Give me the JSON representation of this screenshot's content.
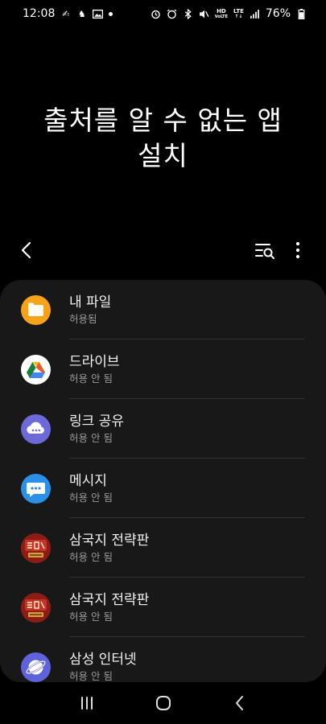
{
  "status_bar": {
    "time": "12:08",
    "network_top": "HD",
    "network_bottom": "VoLTE",
    "lte_top": "LTE",
    "battery": "76%"
  },
  "title": "출처를 알 수 없는 앱\n설치",
  "apps": [
    {
      "name": "내 파일",
      "status": "허용됨",
      "icon": "folder-icon",
      "color": "#f7a21b"
    },
    {
      "name": "드라이브",
      "status": "허용 안 됨",
      "icon": "google-drive-icon",
      "color": "#ffffff"
    },
    {
      "name": "링크 공유",
      "status": "허용 안 됨",
      "icon": "link-share-cloud-icon",
      "color": "#6c6ad8"
    },
    {
      "name": "메시지",
      "status": "허용 안 됨",
      "icon": "message-bubble-icon",
      "color": "#2b90e8"
    },
    {
      "name": "삼국지 전략판",
      "status": "허용 안 됨",
      "icon": "sanguozhi-game-icon",
      "color": "#8b1d14"
    },
    {
      "name": "삼국지 전략판",
      "status": "허용 안 됨",
      "icon": "sanguozhi-game-icon",
      "color": "#8b1d14"
    },
    {
      "name": "삼성 인터넷",
      "status": "허용 안 됨",
      "icon": "samsung-internet-icon",
      "color": "#5f63db"
    }
  ]
}
